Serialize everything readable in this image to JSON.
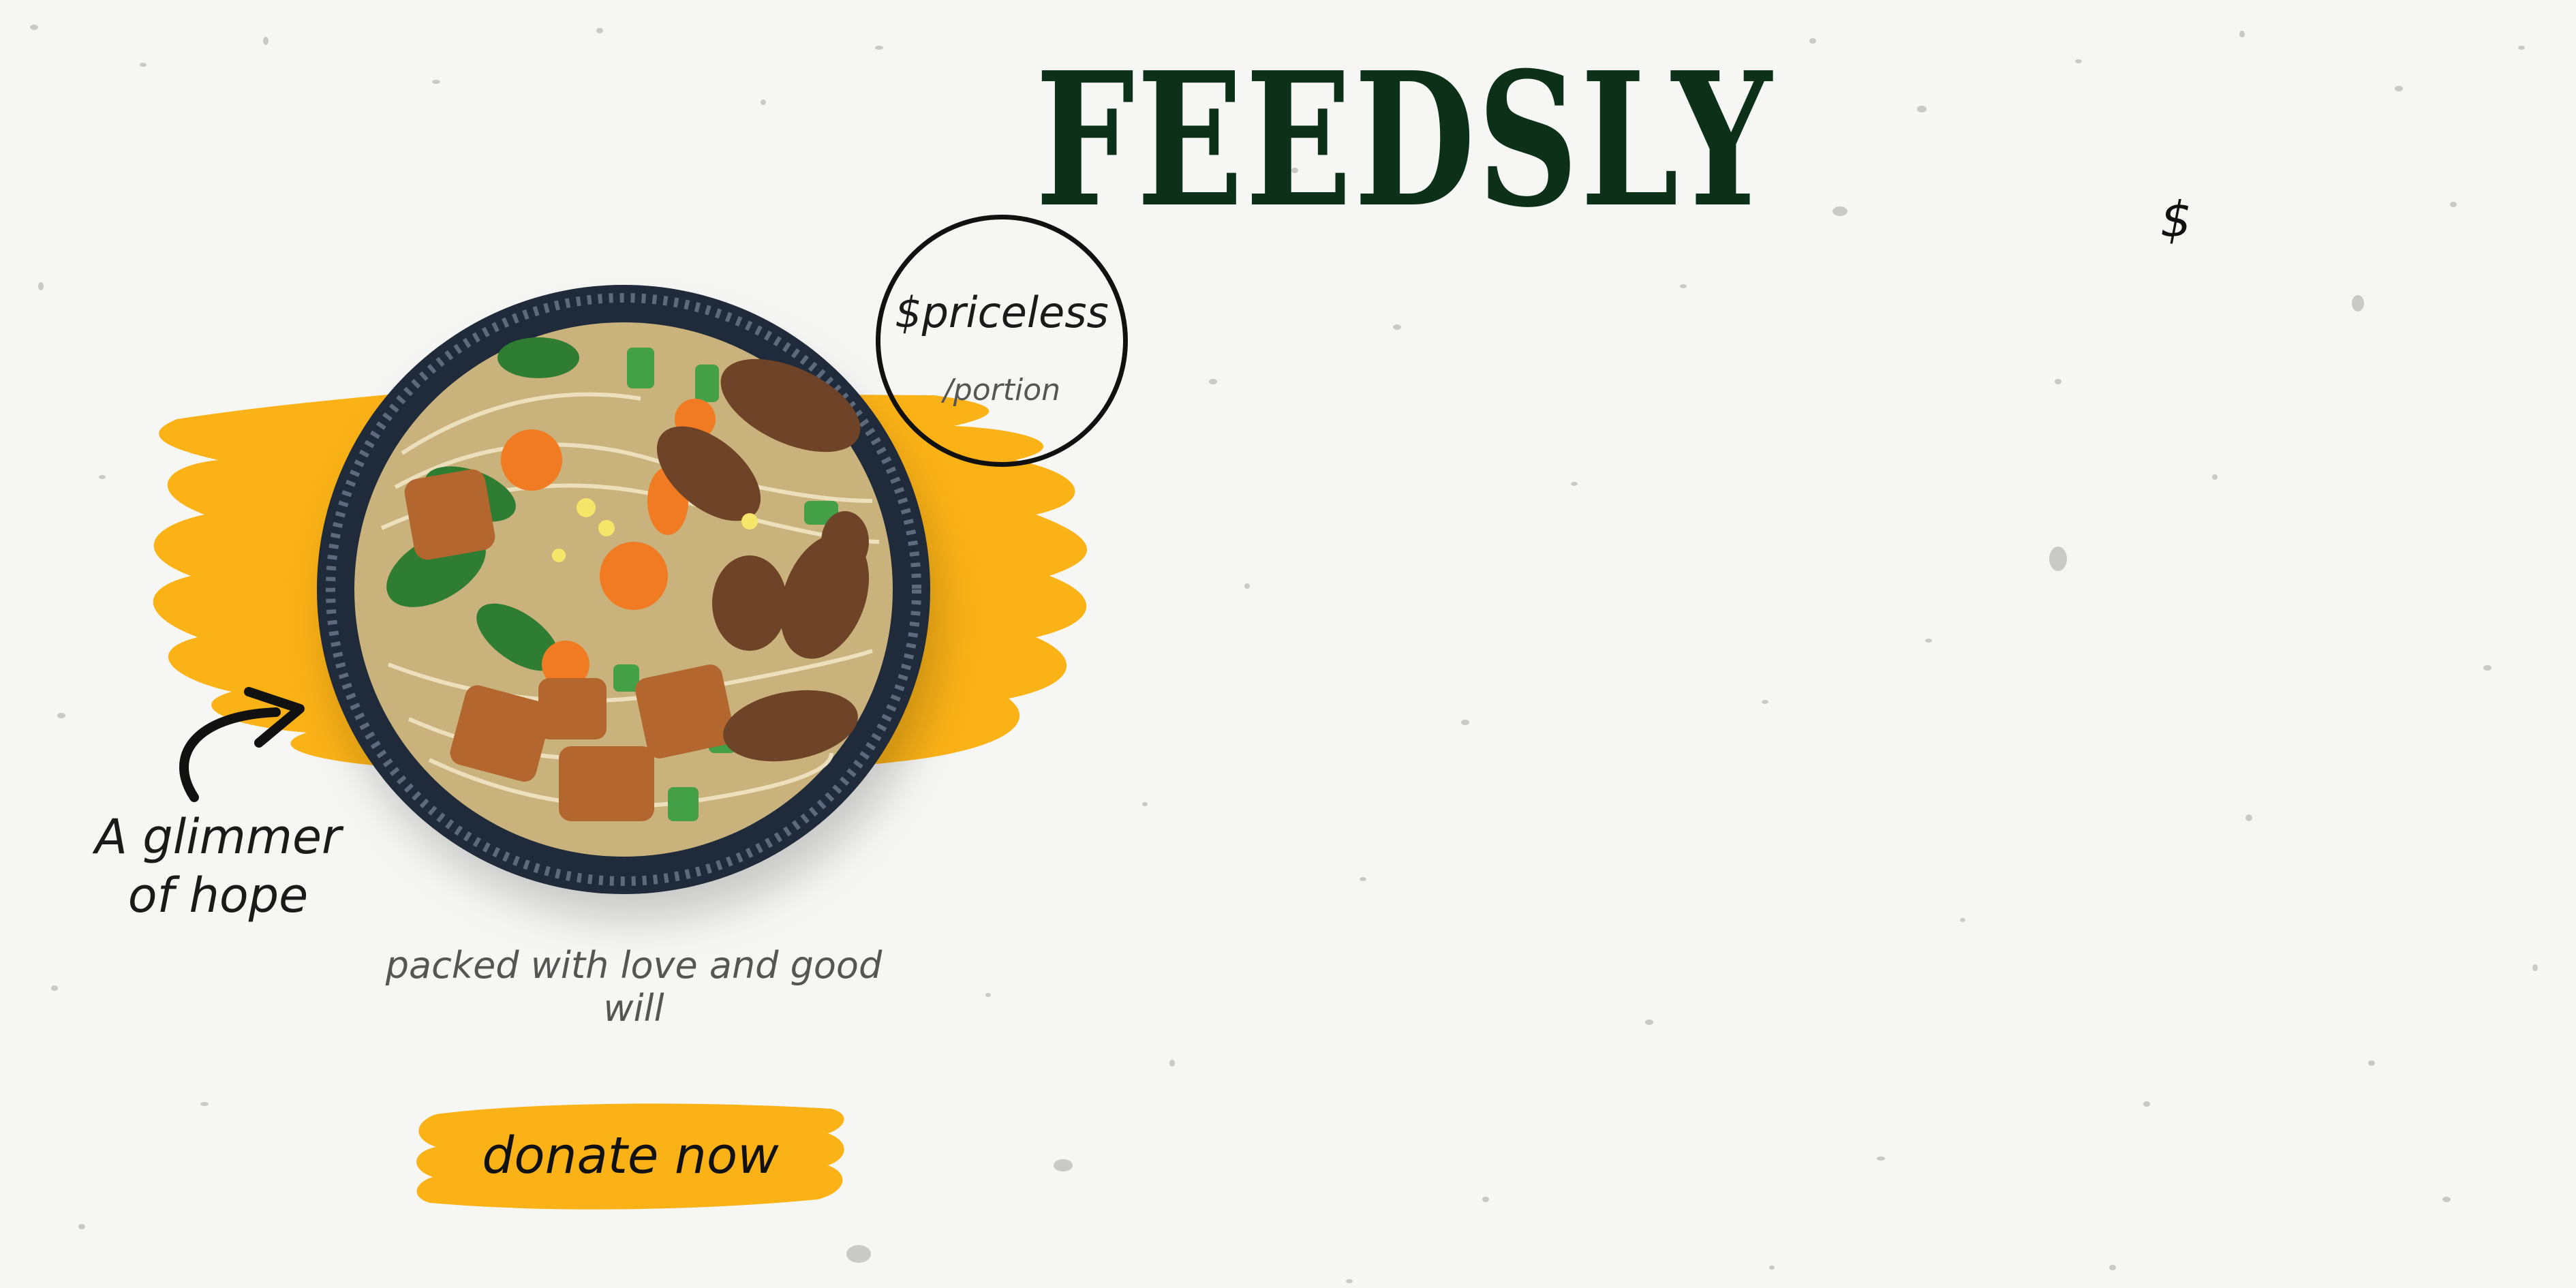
{
  "brand": {
    "name": "FEEDSLY",
    "color": "#0d3118"
  },
  "price": {
    "amount": "$priceless",
    "unit": "/portion"
  },
  "decor": {
    "dollar_sign": "$"
  },
  "hero": {
    "callout": [
      "A glimmer",
      "of hope"
    ],
    "tagline": "packed with love and good will",
    "image": "noodle-soup-bowl-with-tofu-mushrooms-carrots-greens"
  },
  "cta": {
    "label": "donate now"
  },
  "colors": {
    "background": "#f6f6f4",
    "accent_brush": "#fbb217",
    "text": "#111111"
  }
}
